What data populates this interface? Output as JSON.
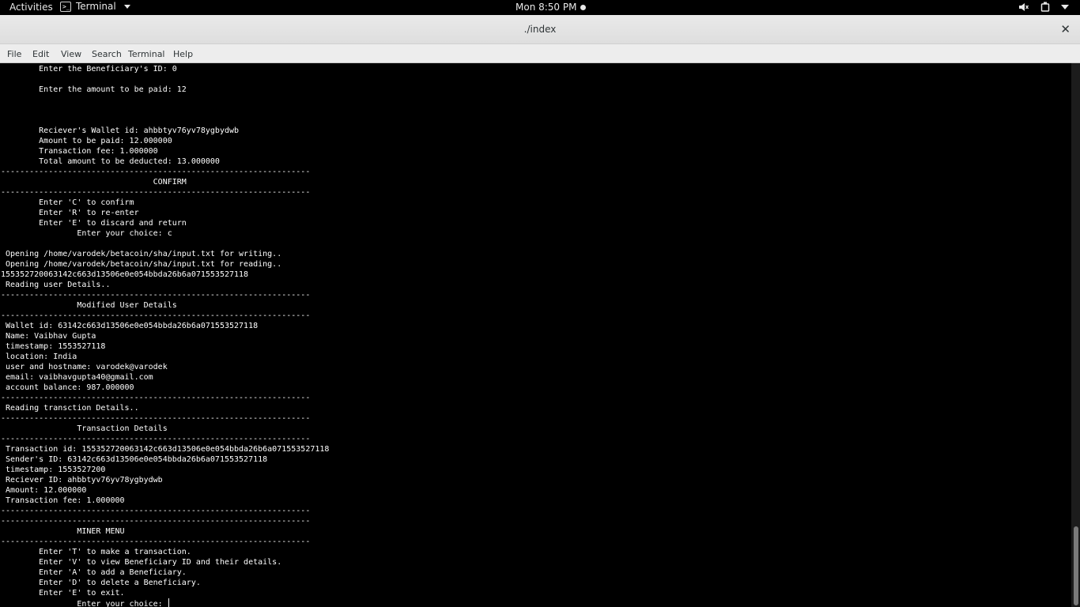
{
  "topbar": {
    "activities": "Activities",
    "app_name": "Terminal",
    "clock": "Mon  8:50 PM"
  },
  "window": {
    "title": "./index",
    "close_glyph": "✕"
  },
  "menubar": [
    "File",
    "Edit",
    "View",
    "Search",
    "Terminal",
    "Help"
  ],
  "terminal": {
    "lines": [
      "        Enter the Beneficiary's ID: 0",
      "",
      "        Enter the amount to be paid: 12",
      "",
      "",
      "",
      "        Reciever's Wallet id: ahbbtyv76yv78ygbydwb",
      "        Amount to be paid: 12.000000",
      "        Transaction fee: 1.000000",
      "        Total amount to be deducted: 13.000000",
      "-----------------------------------------------------------------",
      "                                CONFIRM",
      "-----------------------------------------------------------------",
      "        Enter 'C' to confirm",
      "        Enter 'R' to re-enter",
      "        Enter 'E' to discard and return",
      "                Enter your choice: c",
      "",
      " Opening /home/varodek/betacoin/sha/input.txt for writing..",
      " Opening /home/varodek/betacoin/sha/input.txt for reading..",
      "155352720063142c663d13506e0e054bbda26b6a071553527118",
      " Reading user Details..",
      "-----------------------------------------------------------------",
      "                Modified User Details",
      "-----------------------------------------------------------------",
      " Wallet id: 63142c663d13506e0e054bbda26b6a071553527118",
      " Name: Vaibhav Gupta",
      " timestamp: 1553527118",
      " location: India",
      " user and hostname: varodek@varodek",
      " email: vaibhavgupta40@gmail.com",
      " account balance: 987.000000",
      "-----------------------------------------------------------------",
      " Reading transction Details..",
      "-----------------------------------------------------------------",
      "                Transaction Details",
      "-----------------------------------------------------------------",
      " Transaction id: 155352720063142c663d13506e0e054bbda26b6a071553527118",
      " Sender's ID: 63142c663d13506e0e054bbda26b6a071553527118",
      " timestamp: 1553527200",
      " Reciever ID: ahbbtyv76yv78ygbydwb",
      " Amount: 12.000000",
      " Transaction fee: 1.000000",
      "-----------------------------------------------------------------",
      "-----------------------------------------------------------------",
      "                MINER MENU",
      "-----------------------------------------------------------------",
      "        Enter 'T' to make a transaction.",
      "        Enter 'V' to view Beneficiary ID and their details.",
      "        Enter 'A' to add a Beneficiary.",
      "        Enter 'D' to delete a Beneficiary.",
      "        Enter 'E' to exit.",
      "                Enter your choice: "
    ]
  },
  "icons": {
    "terminal_app": "terminal-icon",
    "volume": "volume-muted-icon",
    "power": "power-icon",
    "system_menu": "chevron-down-icon"
  },
  "colors": {
    "terminal_bg": "#000000",
    "terminal_fg": "#ffffff",
    "titlebar_bg": "#e4e4e4",
    "topbar_bg": "#000000"
  }
}
